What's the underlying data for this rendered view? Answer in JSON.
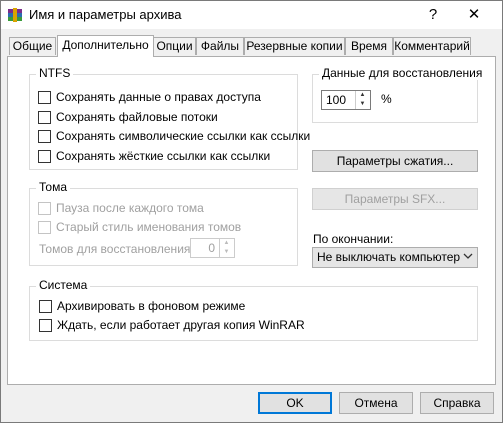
{
  "window": {
    "title": "Имя и параметры архива",
    "help_glyph": "?",
    "close_glyph": "✕"
  },
  "tabs": [
    {
      "label": "Общие"
    },
    {
      "label": "Дополнительно"
    },
    {
      "label": "Опции"
    },
    {
      "label": "Файлы"
    },
    {
      "label": "Резервные копии"
    },
    {
      "label": "Время"
    },
    {
      "label": "Комментарий"
    }
  ],
  "active_tab": "Дополнительно",
  "ntfs": {
    "title": "NTFS",
    "options": [
      {
        "label": "Сохранять данные о правах доступа",
        "checked": false
      },
      {
        "label": "Сохранять файловые потоки",
        "checked": false
      },
      {
        "label": "Сохранять символические ссылки как ссылки",
        "checked": false
      },
      {
        "label": "Сохранять жёсткие ссылки как ссылки",
        "checked": false
      }
    ]
  },
  "recovery": {
    "title": "Данные для восстановления",
    "value": "100",
    "unit": "%"
  },
  "buttons": {
    "compression": "Параметры сжатия...",
    "sfx": "Параметры SFX...",
    "ok": "OK",
    "cancel": "Отмена",
    "help": "Справка"
  },
  "volume": {
    "title": "Тома",
    "options": [
      {
        "label": "Пауза после каждого тома",
        "checked": false
      },
      {
        "label": "Старый стиль именования томов",
        "checked": false
      }
    ],
    "recovery_volumes_label": "Томов для восстановления:",
    "recovery_volumes_value": "0"
  },
  "on_finish": {
    "label": "По окончании:",
    "selected": "Не выключать компьютер"
  },
  "system": {
    "title": "Система",
    "options": [
      {
        "label": "Архивировать в фоновом режиме",
        "checked": false
      },
      {
        "label": "Ждать, если работает другая копия WinRAR",
        "checked": false
      }
    ]
  },
  "colors": {
    "window_bg": "#f0f0f0",
    "panel_bg": "#ffffff",
    "button_bg": "#e1e1e1",
    "default_button_border": "#0078d7",
    "disabled_text": "#a0a0a0"
  },
  "icons": {
    "app": "winrar-icon",
    "spin_up": "triangle-up-icon",
    "spin_down": "triangle-down-icon",
    "combo_arrow": "chevron-down-icon"
  }
}
